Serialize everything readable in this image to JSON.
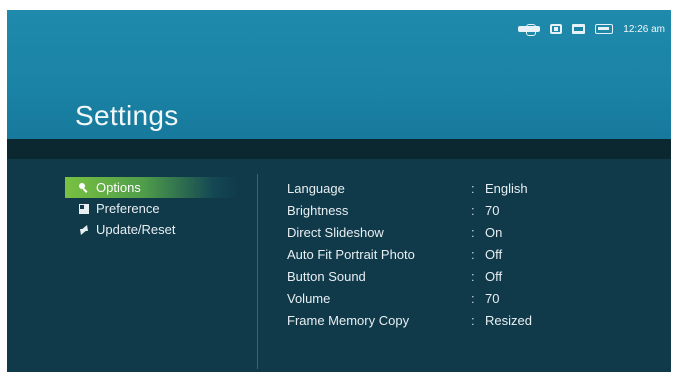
{
  "header": {
    "title": "Settings"
  },
  "status_bar": {
    "icons": [
      "usb-icon",
      "card-icon",
      "memory-icon",
      "battery-icon"
    ],
    "time": "12:26 am"
  },
  "menu": {
    "items": [
      {
        "label": "Options",
        "icon": "search-icon",
        "active": true
      },
      {
        "label": "Preference",
        "icon": "preference-icon",
        "active": false
      },
      {
        "label": "Update/Reset",
        "icon": "update-icon",
        "active": false
      }
    ]
  },
  "settings": {
    "separator": ":",
    "rows": [
      {
        "label": "Language",
        "value": "English"
      },
      {
        "label": "Brightness",
        "value": "70"
      },
      {
        "label": "Direct Slideshow",
        "value": "On"
      },
      {
        "label": "Auto Fit Portrait Photo",
        "value": "Off"
      },
      {
        "label": "Button Sound",
        "value": "Off"
      },
      {
        "label": "Volume",
        "value": "70"
      },
      {
        "label": "Frame Memory Copy",
        "value": "Resized"
      }
    ]
  },
  "colors": {
    "header": "#1a83a6",
    "background": "#10394a",
    "highlight": "#79c142"
  }
}
